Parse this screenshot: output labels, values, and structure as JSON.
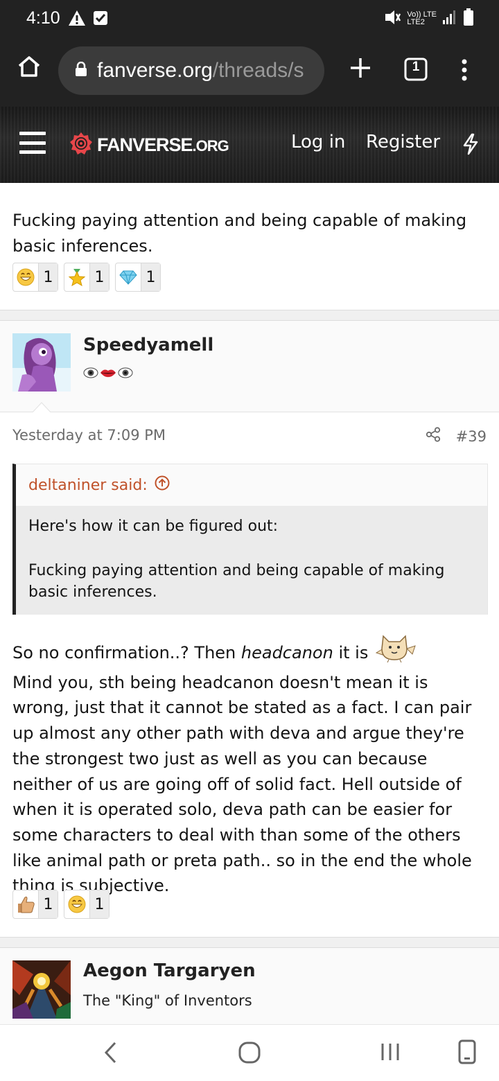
{
  "status_bar": {
    "time": "4:10",
    "left_icons": [
      "warning-icon",
      "checkbox-icon"
    ],
    "right_icons": [
      "vibrate-icon",
      "volte-icon",
      "signal-icon",
      "battery-icon"
    ],
    "volte_label": "Vo)) LTE",
    "volte_sub": "LTE2"
  },
  "browser": {
    "url_host": "fanverse.org",
    "url_path": "/threads/s",
    "tab_count": "1",
    "icons": [
      "home-icon",
      "lock-icon",
      "new-tab-icon",
      "tab-switcher-icon",
      "kebab-menu-icon"
    ]
  },
  "site_header": {
    "logo_main": "FANVERSE",
    "logo_tld": ".ORG",
    "login": "Log in",
    "register": "Register",
    "icons": [
      "hamburger-icon",
      "logo-icon",
      "bolt-icon"
    ]
  },
  "post1": {
    "text": "Fucking paying attention and being capable of making basic inferences.",
    "reactions": [
      {
        "icon": "grin-emoji-icon",
        "count": "1"
      },
      {
        "icon": "star-medal-icon",
        "count": "1"
      },
      {
        "icon": "diamond-icon",
        "count": "1"
      }
    ]
  },
  "post2": {
    "username": "Speedyamell",
    "user_title_icons": [
      "eye-icon",
      "lips-icon",
      "eye-icon"
    ],
    "timestamp": "Yesterday at 7:09 PM",
    "post_number": "#39",
    "quote_author": "deltaniner said:",
    "quote_line1": "Here's how it can be figured out:",
    "quote_line2": "Fucking paying attention and being capable of making basic inferences.",
    "body_line1_a": "So no confirmation..? Then ",
    "body_line1_em": "headcanon",
    "body_line1_b": " it is",
    "body_rest": "Mind you, sth being headcanon doesn't mean it is wrong, just that it cannot be stated as a fact. I can pair up almost any other path with deva and argue they're the strongest two just as well as you can because neither of us are going off of solid fact. Hell outside of when it is operated solo, deva path can be easier for some characters to deal with than some of the others like animal path or preta path.. so in the end the whole thing is subjective.",
    "reactions": [
      {
        "icon": "thumbs-up-icon",
        "count": "1"
      },
      {
        "icon": "grin-emoji-icon",
        "count": "1"
      }
    ]
  },
  "post3": {
    "username": "Aegon Targaryen",
    "user_title": "The \"King\" of Inventors"
  },
  "nav_bar": {
    "icons": [
      "back-icon",
      "home-circle-icon",
      "recents-icon",
      "screen-icon"
    ]
  },
  "colors": {
    "quote_author": "#c0522a",
    "dark_bar": "#222222",
    "logo_accent": "#e8464a"
  }
}
